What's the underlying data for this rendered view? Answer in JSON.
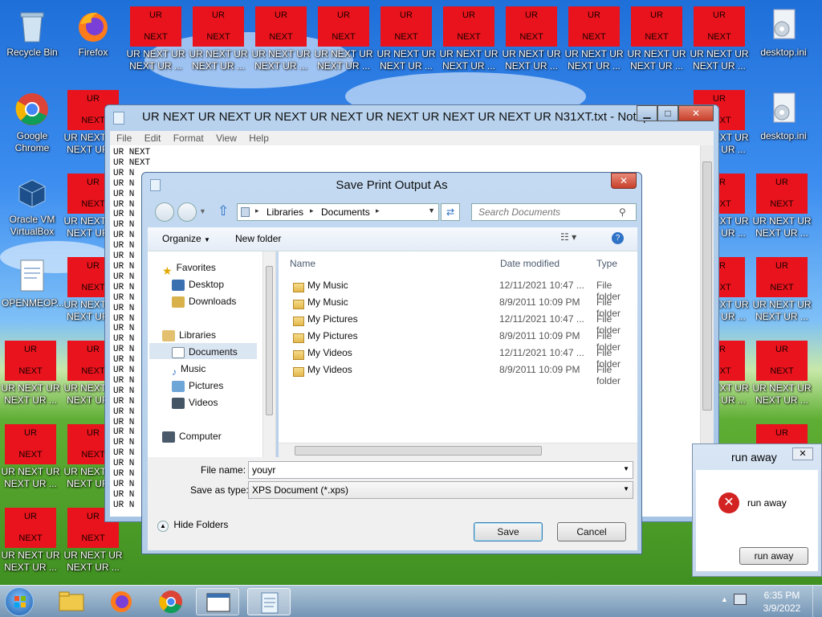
{
  "desktop": {
    "icons": [
      {
        "label": "Recycle Bin"
      },
      {
        "label": "Firefox"
      },
      {
        "label": "Google Chrome"
      },
      {
        "label": "Oracle VM VirtualBox"
      },
      {
        "label": "OPENMEOP..."
      },
      {
        "label": "desktop.ini"
      },
      {
        "label": "desktop.ini"
      }
    ],
    "ur_top": "UR",
    "ur_bottom": "NEXT",
    "ur_caption_1": "UR NEXT UR",
    "ur_caption_2": "NEXT UR ...",
    "ur_caption_short_1": "UR NEXT UR",
    "ur_caption_short_2": "NEXT UR ..."
  },
  "notepad": {
    "title": "UR NEXT UR NEXT UR NEXT UR NEXT UR NEXT UR NEXT UR NEXT UR N31XT.txt - Notepad",
    "menu": [
      "File",
      "Edit",
      "Format",
      "View",
      "Help"
    ],
    "line1": "UR  NEXT",
    "line2": "UR  NEXT",
    "line_rest": "UR  N"
  },
  "dialog": {
    "title": "Save Print Output As",
    "breadcrumb": [
      "Libraries",
      "Documents"
    ],
    "search_placeholder": "Search Documents",
    "organize": "Organize",
    "new_folder": "New folder",
    "nav": {
      "favorites": "Favorites",
      "desktop": "Desktop",
      "downloads": "Downloads",
      "libraries": "Libraries",
      "documents": "Documents",
      "music": "Music",
      "pictures": "Pictures",
      "videos": "Videos",
      "computer": "Computer"
    },
    "columns": {
      "name": "Name",
      "date": "Date modified",
      "type": "Type"
    },
    "files": [
      {
        "name": "My Music",
        "date": "12/11/2021 10:47 ...",
        "type": "File folder"
      },
      {
        "name": "My Music",
        "date": "8/9/2011 10:09 PM",
        "type": "File folder"
      },
      {
        "name": "My Pictures",
        "date": "12/11/2021 10:47 ...",
        "type": "File folder"
      },
      {
        "name": "My Pictures",
        "date": "8/9/2011 10:09 PM",
        "type": "File folder"
      },
      {
        "name": "My Videos",
        "date": "12/11/2021 10:47 ...",
        "type": "File folder"
      },
      {
        "name": "My Videos",
        "date": "8/9/2011 10:09 PM",
        "type": "File folder"
      }
    ],
    "file_name_label": "File name:",
    "file_name_value": "youyr",
    "save_as_type_label": "Save as type:",
    "save_as_type_value": "XPS Document (*.xps)",
    "hide_folders": "Hide Folders",
    "save": "Save",
    "cancel": "Cancel"
  },
  "runaway": {
    "title": "run away",
    "message": "run away",
    "button": "run away"
  },
  "taskbar": {
    "time": "6:35 PM",
    "date": "3/9/2022"
  }
}
